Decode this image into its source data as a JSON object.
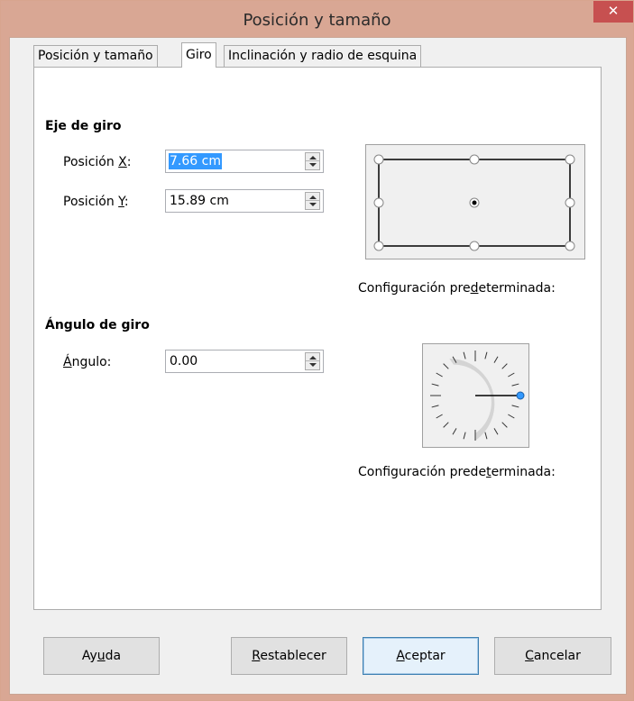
{
  "window": {
    "title": "Posición y tamaño",
    "close_glyph": "✕"
  },
  "tabs": [
    {
      "label": "Posición y tamaño",
      "active": false
    },
    {
      "label": "Giro",
      "active": true
    },
    {
      "label": "Inclinación y radio de esquina",
      "active": false
    }
  ],
  "pivot": {
    "heading": "Eje de giro",
    "pos_x": {
      "label_before": "Posición ",
      "mnemonic": "X",
      "label_after": ":",
      "value": "7.66 cm"
    },
    "pos_y": {
      "label_before": "Posición ",
      "mnemonic": "Y",
      "label_after": ":",
      "value": "15.89 cm"
    },
    "default_settings": {
      "before": "Configuración pre",
      "mnemonic": "d",
      "after": "eterminada:"
    },
    "selected_point": "center"
  },
  "rotation": {
    "heading": "Ángulo de giro",
    "angle": {
      "mnemonic": "Á",
      "label_rest": "ngulo:",
      "value": "0.00"
    },
    "dial_angle_degrees": 0,
    "default_settings": {
      "before": "Configuración prede",
      "mnemonic": "t",
      "after": "erminada:"
    }
  },
  "buttons": {
    "help": {
      "before": "Ay",
      "mnemonic": "u",
      "after": "da"
    },
    "reset": {
      "before": "",
      "mnemonic": "R",
      "after": "establecer"
    },
    "ok": {
      "before": "",
      "mnemonic": "A",
      "after": "ceptar"
    },
    "cancel": {
      "before": "",
      "mnemonic": "C",
      "after": "ancelar"
    }
  },
  "colors": {
    "titlebar": "#d9a794",
    "close_button": "#c75050",
    "selection": "#3399ff",
    "dial_knob": "#3399ff"
  }
}
